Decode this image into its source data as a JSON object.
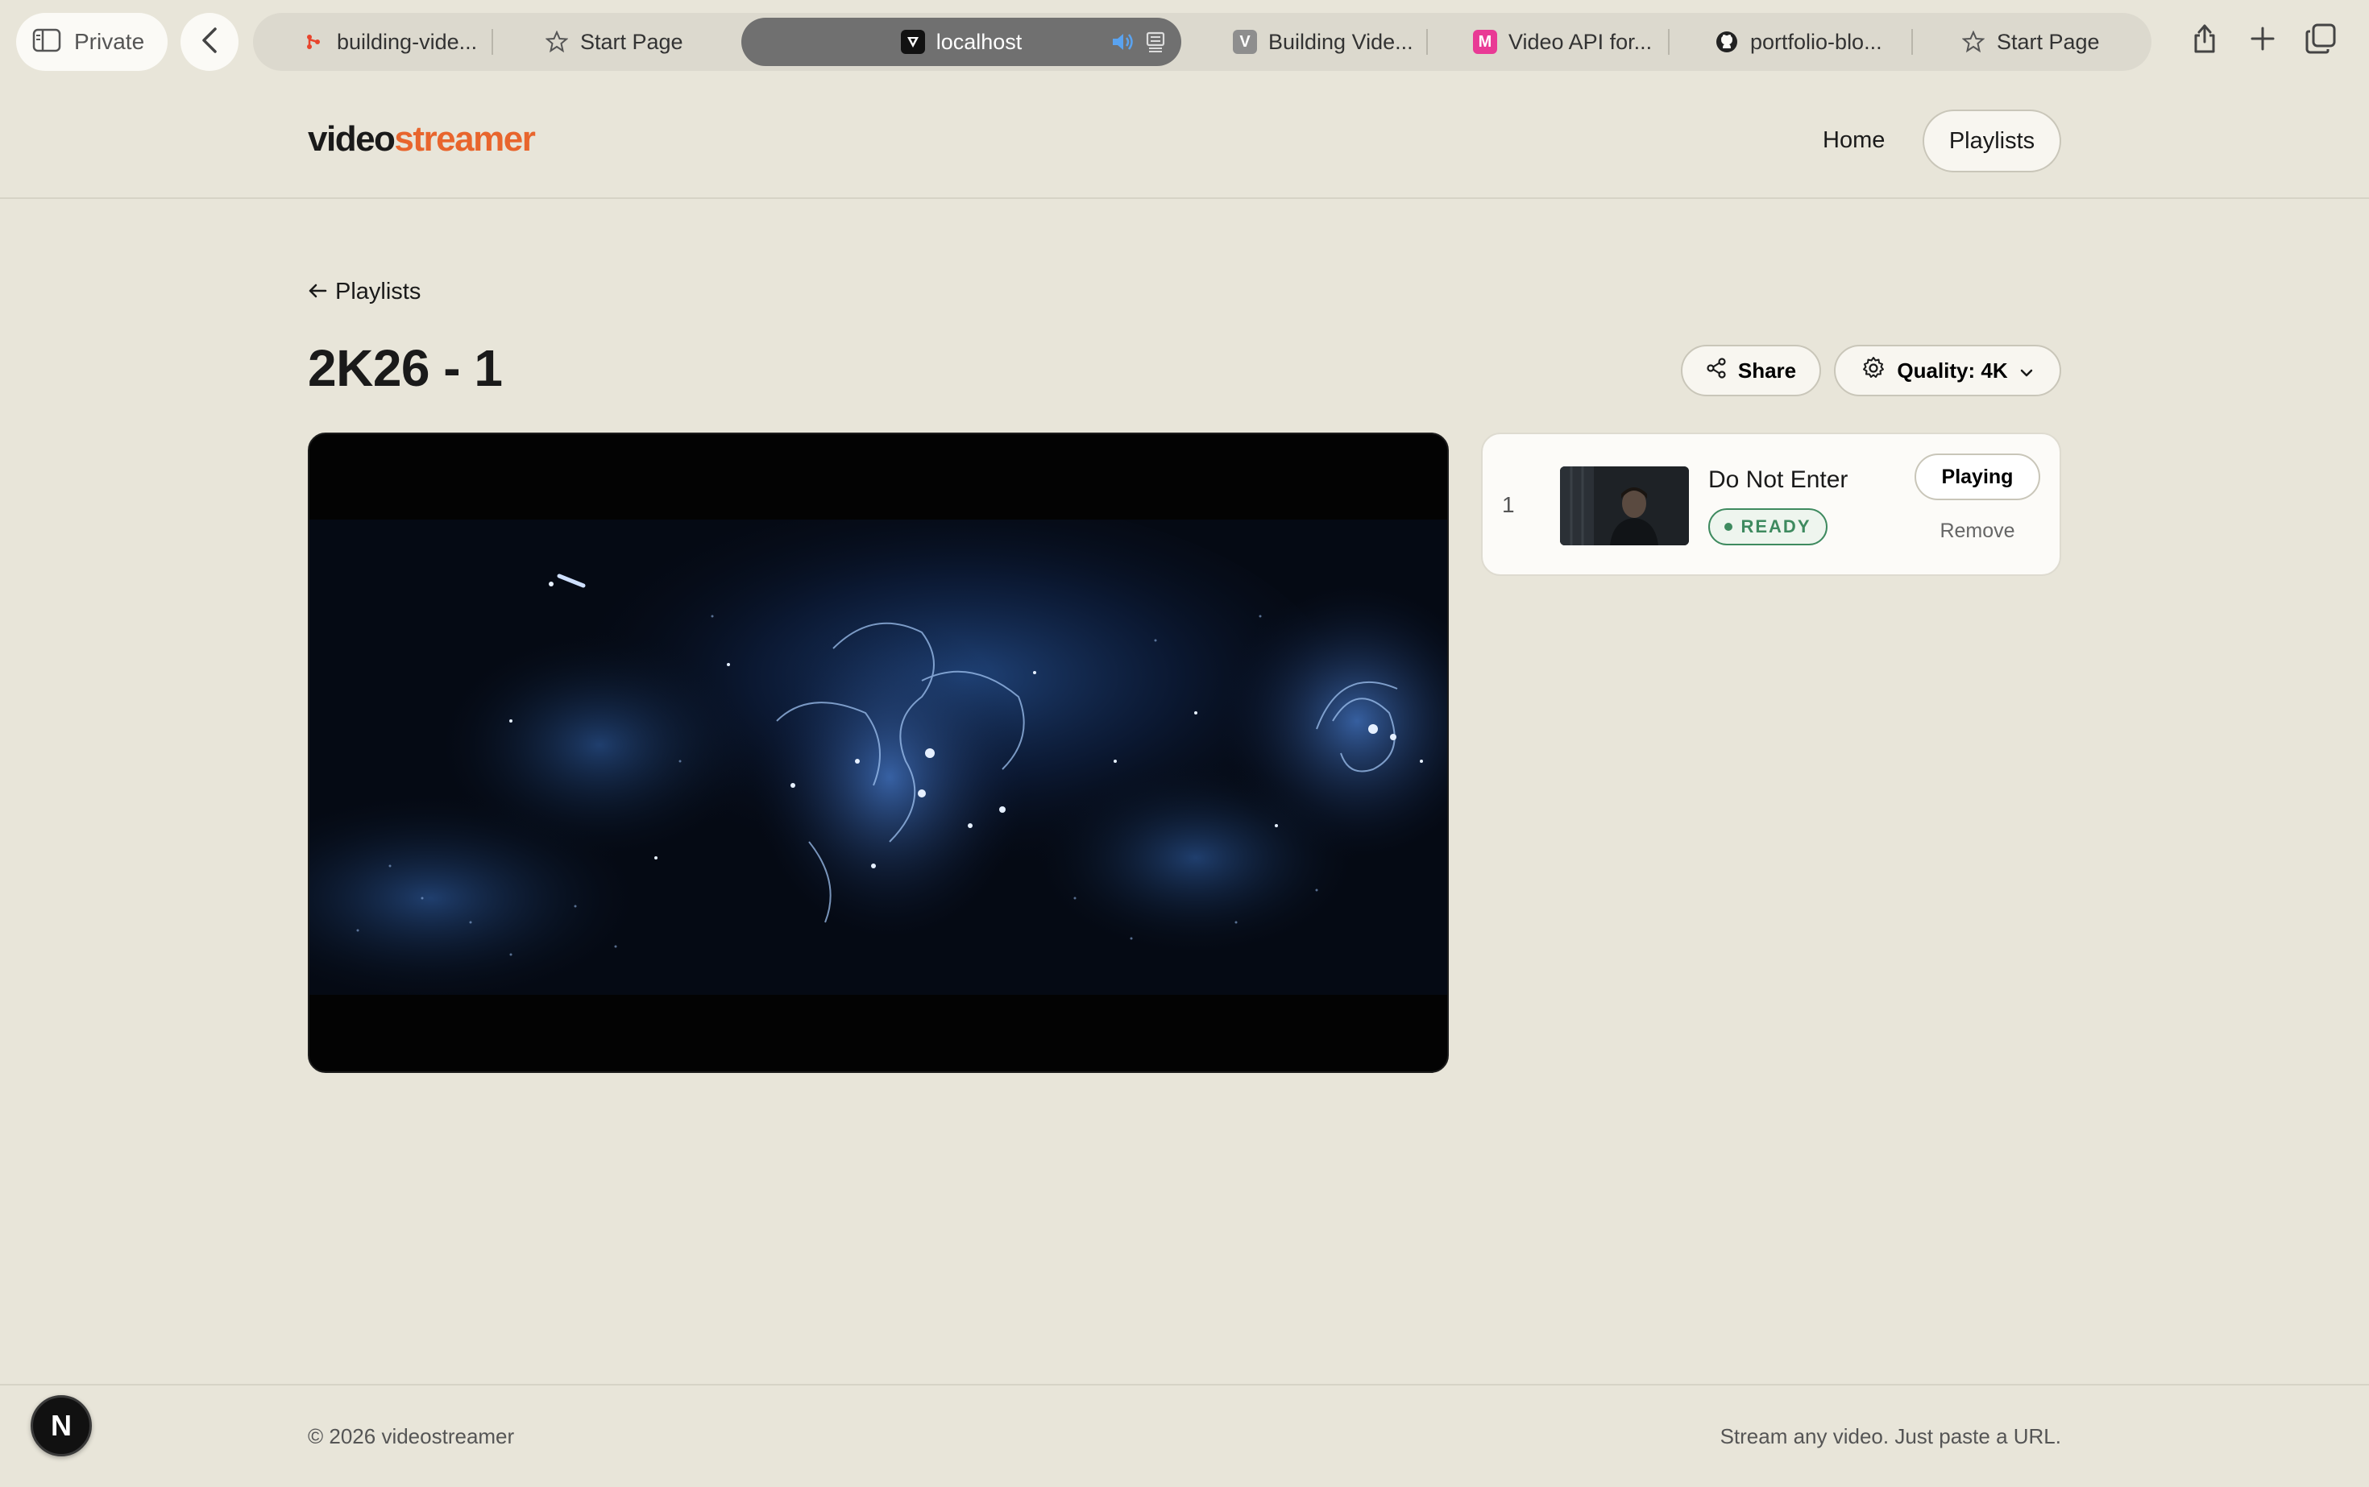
{
  "browser": {
    "private_label": "Private",
    "tabs": [
      {
        "label": "building-vide...",
        "icon": "git-icon"
      },
      {
        "label": "Start Page",
        "icon": "star-icon"
      },
      {
        "label": "localhost",
        "icon": "vercel-icon",
        "active": true
      },
      {
        "label": "Building Vide...",
        "icon": "v-icon"
      },
      {
        "label": "Video API for...",
        "icon": "mux-icon"
      },
      {
        "label": "portfolio-blo...",
        "icon": "github-icon"
      },
      {
        "label": "Start Page",
        "icon": "star-icon"
      }
    ]
  },
  "site": {
    "logo_part1": "video",
    "logo_part2": "streamer",
    "nav": {
      "home": "Home",
      "playlists": "Playlists"
    },
    "accent_color": "#e8652d"
  },
  "page": {
    "back_label": "Playlists",
    "title": "2K26 - 1",
    "share_label": "Share",
    "quality_label": "Quality: 4K"
  },
  "queue": [
    {
      "index": "1",
      "title": "Do Not Enter",
      "status": "READY",
      "action_primary": "Playing",
      "action_secondary": "Remove"
    }
  ],
  "footer": {
    "copyright": "© 2026 videostreamer",
    "tagline": "Stream any video. Just paste a URL."
  },
  "dev_badge": "N"
}
